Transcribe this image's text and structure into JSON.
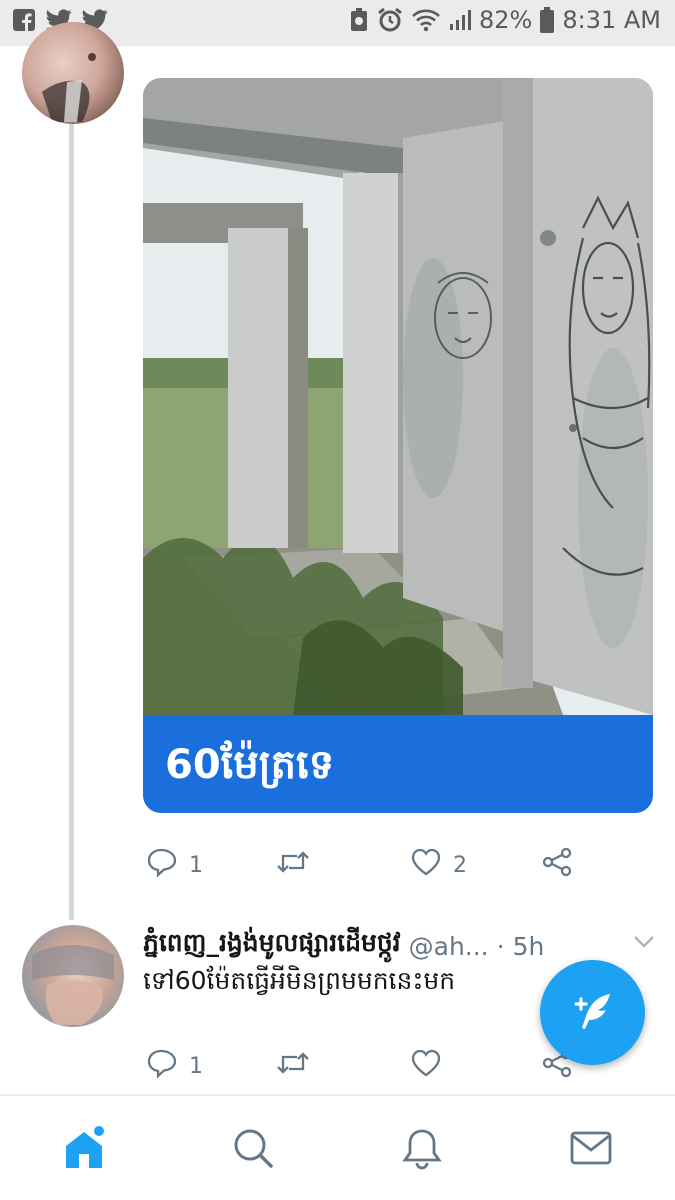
{
  "status_bar": {
    "left_icons": [
      "facebook-icon",
      "twitter-icon",
      "twitter-icon"
    ],
    "battery_percent": "82%",
    "time": "8:31 AM"
  },
  "tweet1": {
    "card_caption": "60ម៉ែត្រទេ",
    "reply_count": "1",
    "retweet_count": "",
    "like_count": "2"
  },
  "tweet2": {
    "author": "ភ្នំពេញ_រង្វង់មូលផ្សារដើមថ្កូវ",
    "handle": "@ah...",
    "separator": "·",
    "time": "5h",
    "text": "ទៅ60ម៉ែតធ្វើអីមិនព្រមមកនេះមក",
    "reply_count": "1",
    "retweet_count": "",
    "like_count": ""
  },
  "colors": {
    "accent": "#1da1f2",
    "card_caption_bg": "#1a6fdc",
    "muted": "#657786",
    "nav_active": "#1da1f2"
  },
  "bottom_nav": [
    "home-icon",
    "search-icon",
    "notifications-icon",
    "messages-icon"
  ]
}
